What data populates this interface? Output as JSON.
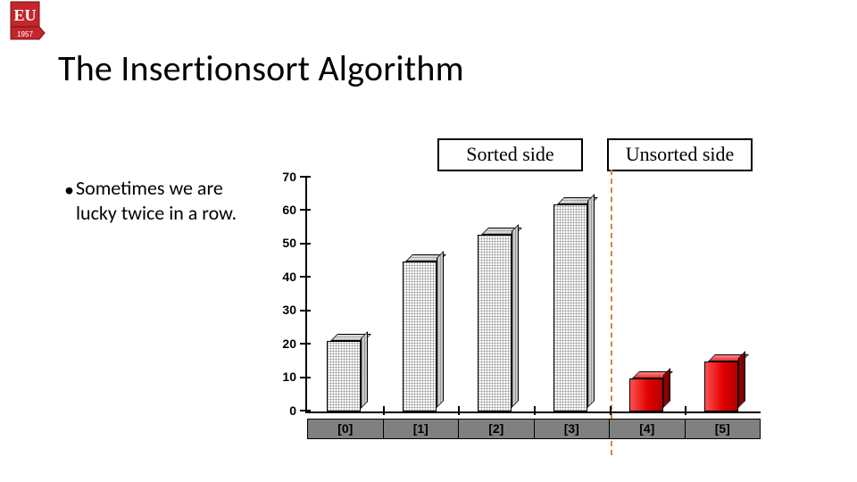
{
  "logo": {
    "letters": "EU",
    "year": "1957"
  },
  "title": "The Insertionsort Algorithm",
  "bullet": {
    "dot": "•",
    "text": "Sometimes we are lucky twice in a row."
  },
  "labels": {
    "sorted": "Sorted side",
    "unsorted": "Unsorted side"
  },
  "chart_data": {
    "type": "bar",
    "title": "",
    "xlabel": "",
    "ylabel": "",
    "ylim": [
      0,
      70
    ],
    "yticks": [
      0,
      10,
      20,
      30,
      40,
      50,
      60,
      70
    ],
    "categories": [
      "[0]",
      "[1]",
      "[2]",
      "[3]",
      "[4]",
      "[5]"
    ],
    "values": [
      21,
      45,
      53,
      62,
      10,
      15
    ],
    "series_group": [
      "sorted",
      "sorted",
      "sorted",
      "sorted",
      "unsorted",
      "unsorted"
    ],
    "colors": {
      "sorted": "#d8d8d8",
      "unsorted": "#e20000"
    },
    "divider_after_index": 3
  }
}
